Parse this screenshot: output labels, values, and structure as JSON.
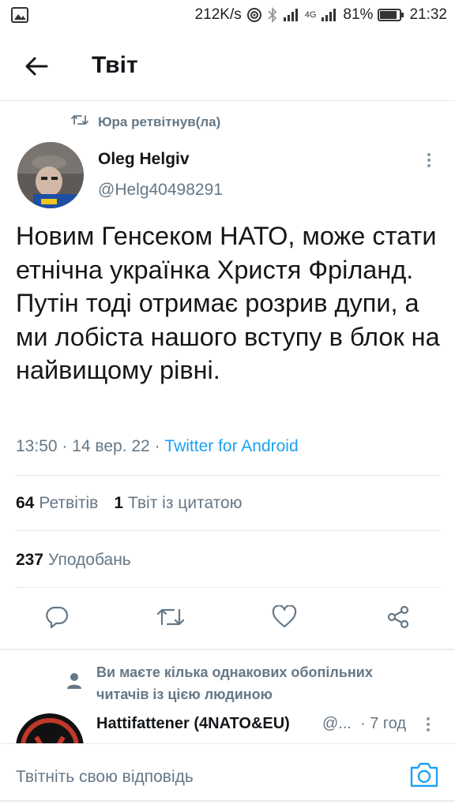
{
  "statusbar": {
    "speed": "212K/s",
    "network": "4G",
    "battery": "81%",
    "time": "21:32"
  },
  "header": {
    "title": "Твіт"
  },
  "tweet": {
    "retweeted_by": "Юра ретвітнув(ла)",
    "author_name": "Oleg Helgiv",
    "author_handle": "@Helg40498291",
    "text": "Новим Генсеком НАТО, може стати етнічна українка Христя Фріланд. Путін тоді отримає розрив дупи, а ми лобіста нашого вступу в блок на найвищому рівні.",
    "time": "13:50",
    "date": "14 вер. 22",
    "source": "Twitter for Android",
    "separator": " · "
  },
  "stats": {
    "retweets_count": "64",
    "retweets_label": "Ретвітів",
    "quotes_count": "1",
    "quotes_label": "Твіт із цитатою",
    "likes_count": "237",
    "likes_label": "Уподобань"
  },
  "actions": [
    "reply-icon",
    "retweet-icon",
    "like-icon",
    "share-icon"
  ],
  "suggestion": {
    "text": "Ви маєте кілька однакових обопільних читачів із цією людиною"
  },
  "reply": {
    "author_name": "Hattifattener (4NATO&EU)",
    "author_handle": "@...",
    "time": "· 7 год"
  },
  "composer": {
    "placeholder": "Твітніть свою відповідь"
  },
  "colors": {
    "accent": "#1da1f2",
    "secondary_text": "#657786",
    "primary_text": "#14171a",
    "divider": "#e6ecf0"
  }
}
